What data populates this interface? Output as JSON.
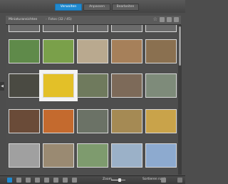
{
  "tabs": [
    {
      "label": "Verwalten",
      "active": true
    },
    {
      "label": "Anpassen",
      "active": false
    },
    {
      "label": "Bearbeiten",
      "active": false
    }
  ],
  "header": {
    "title": "Miniaturansichten",
    "breadcrumb_sep": "›",
    "breadcrumb": "Fotos (32 / 45)"
  },
  "thumbs": [
    {
      "name": "thumb-top-partial-1",
      "color": "#6b6b6b"
    },
    {
      "name": "thumb-top-partial-2",
      "color": "#6b6b6b"
    },
    {
      "name": "thumb-top-partial-3",
      "color": "#6b6b6b"
    },
    {
      "name": "thumb-top-partial-4",
      "color": "#6b6b6b"
    },
    {
      "name": "thumb-top-partial-5",
      "color": "#6b6b6b"
    },
    {
      "name": "thumb-landscape-house",
      "color": "#5f8a4a"
    },
    {
      "name": "thumb-parrot",
      "color": "#7aa04a"
    },
    {
      "name": "thumb-dog-gray",
      "color": "#b9a98f"
    },
    {
      "name": "thumb-dog-brown",
      "color": "#a6805a"
    },
    {
      "name": "thumb-dog-face",
      "color": "#8a7050"
    },
    {
      "name": "thumb-donkey",
      "color": "#4a4a42"
    },
    {
      "name": "thumb-yellow-taxi",
      "color": "#e3c028",
      "selected": true
    },
    {
      "name": "thumb-squirrel",
      "color": "#6f7a5d"
    },
    {
      "name": "thumb-statue-rider",
      "color": "#7d6a59"
    },
    {
      "name": "thumb-cliffs",
      "color": "#7e8b7a"
    },
    {
      "name": "thumb-lizard",
      "color": "#6a4b38"
    },
    {
      "name": "thumb-gourds",
      "color": "#c46a2e"
    },
    {
      "name": "thumb-street-market",
      "color": "#6b7266"
    },
    {
      "name": "thumb-night-city",
      "color": "#a58a54"
    },
    {
      "name": "thumb-taxi-street",
      "color": "#c9a34a"
    },
    {
      "name": "thumb-train-station",
      "color": "#a0a0a0"
    },
    {
      "name": "thumb-old-buildings",
      "color": "#9a8a72"
    },
    {
      "name": "thumb-bridge-trees",
      "color": "#7e9b6e"
    },
    {
      "name": "thumb-clock-tower",
      "color": "#9bb1c8"
    },
    {
      "name": "thumb-mosque",
      "color": "#8daacf"
    }
  ],
  "bottom": {
    "zoom_label": "Zoom",
    "zoom_level": 0.6,
    "sort_label": "Sortieren nach"
  }
}
